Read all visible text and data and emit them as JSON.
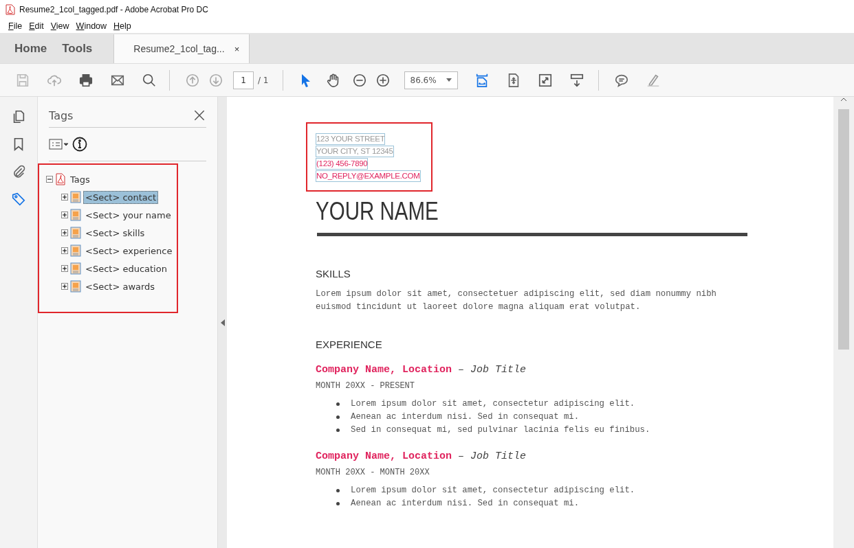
{
  "window": {
    "title": "Resume2_1col_tagged.pdf - Adobe Acrobat Pro DC"
  },
  "menu": [
    "File",
    "Edit",
    "View",
    "Window",
    "Help"
  ],
  "nav_tabs": [
    {
      "label": "Home",
      "selected": false
    },
    {
      "label": "Tools",
      "selected": false
    }
  ],
  "doc_tab": {
    "label": "Resume2_1col_tag...",
    "close": "×",
    "selected": true
  },
  "toolbar": {
    "page_number": "1",
    "page_total": "/ 1",
    "zoom": "86.6%"
  },
  "tags_panel": {
    "title": "Tags",
    "tree": [
      {
        "label": "Tags",
        "kind": "document",
        "expanded": true,
        "selected": false,
        "children": [
          {
            "label": "<Sect> contact",
            "kind": "sect",
            "expanded": false,
            "selected": true
          },
          {
            "label": "<Sect> your name",
            "kind": "sect",
            "expanded": false,
            "selected": false
          },
          {
            "label": "<Sect> skills",
            "kind": "sect",
            "expanded": false,
            "selected": false
          },
          {
            "label": "<Sect> experience",
            "kind": "sect",
            "expanded": false,
            "selected": false
          },
          {
            "label": "<Sect> education",
            "kind": "sect",
            "expanded": false,
            "selected": false
          },
          {
            "label": "<Sect> awards",
            "kind": "sect",
            "expanded": false,
            "selected": false
          }
        ]
      }
    ]
  },
  "document": {
    "contact": [
      {
        "text": "123 YOUR STREET",
        "kind": "plain"
      },
      {
        "text": "YOUR CITY, ST 12345",
        "kind": "plain"
      },
      {
        "text": "(123) 456-7890",
        "kind": "accent"
      },
      {
        "text": "NO_REPLY@EXAMPLE.COM",
        "kind": "accent"
      }
    ],
    "name": "YOUR NAME",
    "sections": [
      {
        "heading": "SKILLS",
        "paragraph": "Lorem ipsum dolor sit amet, consectetuer adipiscing elit, sed diam nonummy nibh euismod tincidunt ut laoreet dolore magna aliquam erat volutpat."
      },
      {
        "heading": "EXPERIENCE",
        "jobs": [
          {
            "company": "Company Name, Location",
            "dash": "–",
            "title": "Job Title",
            "dates": "MONTH 20XX - PRESENT",
            "bullets": [
              "Lorem ipsum dolor sit amet, consectetur adipiscing elit.",
              "Aenean ac interdum nisi. Sed in consequat mi.",
              "Sed in consequat mi, sed pulvinar lacinia felis eu finibus."
            ]
          },
          {
            "company": "Company Name, Location",
            "dash": "–",
            "title": "Job Title",
            "dates": "MONTH 20XX - MONTH 20XX",
            "bullets": [
              "Lorem ipsum dolor sit amet, consectetur adipiscing elit.",
              "Aenean ac interdum nisi. Sed in consequat mi."
            ]
          }
        ]
      }
    ]
  }
}
